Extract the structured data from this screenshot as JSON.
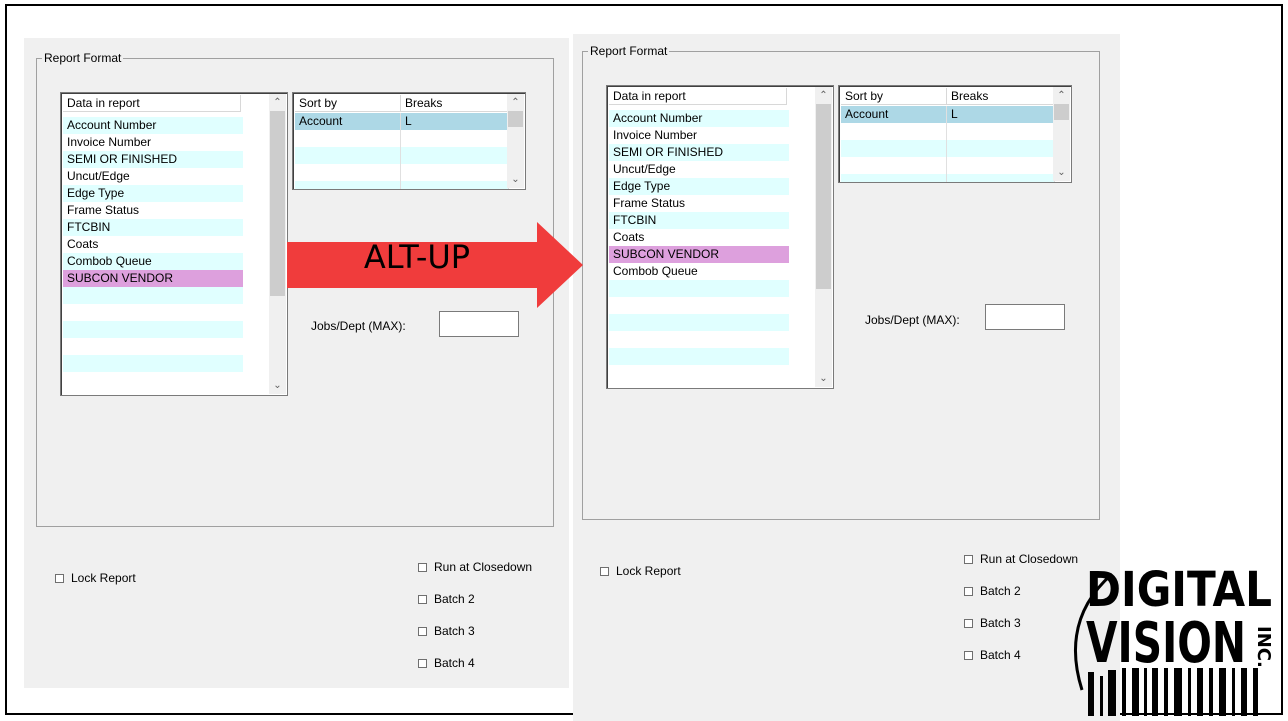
{
  "left": {
    "group_title": "Report Format",
    "data_list": {
      "header": "Data in report",
      "items": [
        {
          "label": "Account Number",
          "style": "alt"
        },
        {
          "label": "Invoice Number",
          "style": ""
        },
        {
          "label": "SEMI OR FINISHED",
          "style": "alt"
        },
        {
          "label": "Uncut/Edge",
          "style": ""
        },
        {
          "label": "Edge Type",
          "style": "alt"
        },
        {
          "label": "Frame Status",
          "style": ""
        },
        {
          "label": "FTCBIN",
          "style": "alt"
        },
        {
          "label": "Coats",
          "style": ""
        },
        {
          "label": "Combob Queue",
          "style": "alt"
        },
        {
          "label": "SUBCON VENDOR",
          "style": "sel-pink"
        },
        {
          "label": "",
          "style": "alt"
        },
        {
          "label": "",
          "style": ""
        },
        {
          "label": "",
          "style": "alt"
        },
        {
          "label": "",
          "style": ""
        },
        {
          "label": "",
          "style": "alt"
        },
        {
          "label": "",
          "style": ""
        }
      ]
    },
    "sort_grid": {
      "headers": [
        "Sort by",
        "Breaks"
      ],
      "rows": [
        {
          "cells": [
            "Account",
            "L"
          ],
          "style": "sel-blue"
        },
        {
          "cells": [
            "",
            ""
          ],
          "style": ""
        },
        {
          "cells": [
            "",
            ""
          ],
          "style": "alt"
        },
        {
          "cells": [
            "",
            ""
          ],
          "style": ""
        },
        {
          "cells": [
            "",
            ""
          ],
          "style": "alt"
        }
      ]
    },
    "jobs_label": "Jobs/Dept (MAX):",
    "jobs_value": "",
    "lock_label": "Lock Report",
    "run_label": "Run at Closedown",
    "batch2_label": "Batch 2",
    "batch3_label": "Batch 3",
    "batch4_label": "Batch 4"
  },
  "right": {
    "group_title": "Report Format",
    "data_list": {
      "header": "Data in report",
      "items": [
        {
          "label": "Account Number",
          "style": "alt"
        },
        {
          "label": "Invoice Number",
          "style": ""
        },
        {
          "label": "SEMI OR FINISHED",
          "style": "alt"
        },
        {
          "label": "Uncut/Edge",
          "style": ""
        },
        {
          "label": "Edge Type",
          "style": "alt"
        },
        {
          "label": "Frame Status",
          "style": ""
        },
        {
          "label": "FTCBIN",
          "style": "alt"
        },
        {
          "label": "Coats",
          "style": ""
        },
        {
          "label": "SUBCON VENDOR",
          "style": "sel-pink"
        },
        {
          "label": "Combob Queue",
          "style": ""
        },
        {
          "label": "",
          "style": "alt"
        },
        {
          "label": "",
          "style": ""
        },
        {
          "label": "",
          "style": "alt"
        },
        {
          "label": "",
          "style": ""
        },
        {
          "label": "",
          "style": "alt"
        },
        {
          "label": "",
          "style": ""
        }
      ]
    },
    "sort_grid": {
      "headers": [
        "Sort by",
        "Breaks"
      ],
      "rows": [
        {
          "cells": [
            "Account",
            "L"
          ],
          "style": "sel-blue"
        },
        {
          "cells": [
            "",
            ""
          ],
          "style": ""
        },
        {
          "cells": [
            "",
            ""
          ],
          "style": "alt"
        },
        {
          "cells": [
            "",
            ""
          ],
          "style": ""
        },
        {
          "cells": [
            "",
            ""
          ],
          "style": "alt"
        }
      ]
    },
    "jobs_label": "Jobs/Dept (MAX):",
    "jobs_value": "",
    "lock_label": "Lock Report",
    "run_label": "Run at Closedown",
    "batch2_label": "Batch 2",
    "batch3_label": "Batch 3",
    "batch4_label": "Batch 4"
  },
  "arrow": {
    "label": "ALT-UP",
    "color": "#f03c3c"
  },
  "logo": {
    "line1": "DIGITAL",
    "line2": "VISION",
    "suffix": "INC."
  },
  "colors": {
    "row_alt": "#e0ffff",
    "row_selected": "#add8e6",
    "row_highlight": "#dda0dd",
    "panel_bg": "#f0f0f0"
  }
}
